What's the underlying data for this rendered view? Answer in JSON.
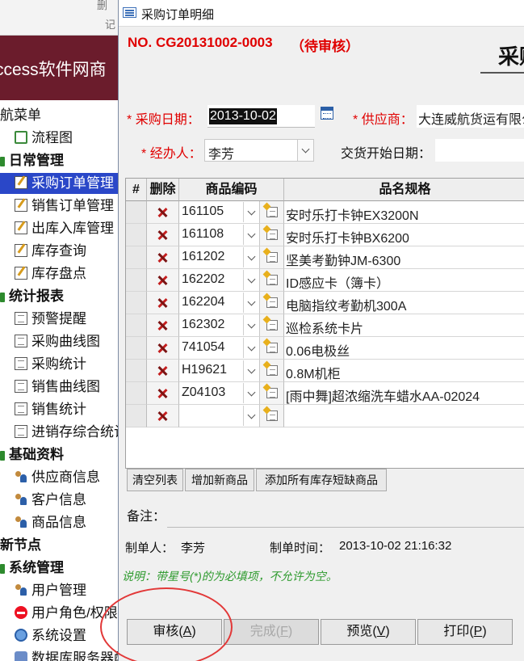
{
  "background_app": {
    "top_fragment_1": "删",
    "top_fragment_2": "记",
    "banner_text": "ccess软件网商",
    "nav": [
      {
        "label": "航菜单",
        "type": "header",
        "icon": ""
      },
      {
        "label": "流程图",
        "type": "item",
        "icon": "flowchart-icon"
      },
      {
        "label": "日常管理",
        "type": "group",
        "icon": "group-icon"
      },
      {
        "label": "采购订单管理",
        "type": "item",
        "icon": "edit-form-icon",
        "selected": true
      },
      {
        "label": "销售订单管理",
        "type": "item",
        "icon": "edit-form-icon"
      },
      {
        "label": "出库入库管理",
        "type": "item",
        "icon": "edit-form-icon"
      },
      {
        "label": "库存查询",
        "type": "item",
        "icon": "edit-form-icon"
      },
      {
        "label": "库存盘点",
        "type": "item",
        "icon": "edit-form-icon"
      },
      {
        "label": "统计报表",
        "type": "group",
        "icon": "group-icon"
      },
      {
        "label": "预警提醒",
        "type": "item",
        "icon": "report-icon"
      },
      {
        "label": "采购曲线图",
        "type": "item",
        "icon": "report-icon"
      },
      {
        "label": "采购统计",
        "type": "item",
        "icon": "report-icon"
      },
      {
        "label": "销售曲线图",
        "type": "item",
        "icon": "report-icon"
      },
      {
        "label": "销售统计",
        "type": "item",
        "icon": "report-icon"
      },
      {
        "label": "进销存综合统计",
        "type": "item",
        "icon": "report-icon"
      },
      {
        "label": "基础资料",
        "type": "group",
        "icon": "group-icon"
      },
      {
        "label": "供应商信息",
        "type": "item",
        "icon": "users-icon"
      },
      {
        "label": "客户信息",
        "type": "item",
        "icon": "users-icon"
      },
      {
        "label": "商品信息",
        "type": "item",
        "icon": "goods-icon"
      },
      {
        "label": "新节点",
        "type": "group",
        "icon": ""
      },
      {
        "label": "系统管理",
        "type": "group",
        "icon": "group-icon"
      },
      {
        "label": "用户管理",
        "type": "item",
        "icon": "users-icon"
      },
      {
        "label": "用户角色/权限",
        "type": "item",
        "icon": "no-entry-icon"
      },
      {
        "label": "系统设置",
        "type": "item",
        "icon": "gear-icon"
      },
      {
        "label": "数据库服务器配置",
        "type": "item",
        "icon": "network-icon"
      }
    ]
  },
  "dialog": {
    "window_title": "采购订单明细",
    "order_no": "NO. CG20131002-0003",
    "order_status": "（待审核）",
    "big_title": "采购",
    "purchase_date": {
      "required_mark": "*",
      "label": "采购日期：",
      "value": "2013-10-02"
    },
    "supplier": {
      "required_mark": "*",
      "label": "供应商：",
      "value": "大连威航货运有限公司"
    },
    "handler": {
      "required_mark": "*",
      "label": "经办人：",
      "value": "李芳"
    },
    "delivery_start": {
      "label": "交货开始日期：",
      "value": ""
    },
    "grid": {
      "headers": {
        "select": "#",
        "delete": "删除",
        "code": "商品编码",
        "name": "品名规格"
      },
      "rows": [
        {
          "code": "161105",
          "name": "安时乐打卡钟EX3200N"
        },
        {
          "code": "161108",
          "name": "安时乐打卡钟BX6200"
        },
        {
          "code": "161202",
          "name": "坚美考勤钟JM-6300"
        },
        {
          "code": "162202",
          "name": "ID感应卡（簿卡）"
        },
        {
          "code": "162204",
          "name": "电脑指纹考勤机300A"
        },
        {
          "code": "162302",
          "name": "巡检系统卡片"
        },
        {
          "code": "741054",
          "name": "0.06电极丝"
        },
        {
          "code": "H19621",
          "name": "0.8M机柜"
        },
        {
          "code": "Z04103",
          "name": "[雨中舞]超浓缩洗车蜡水AA-02024"
        },
        {
          "code": "",
          "name": ""
        }
      ]
    },
    "grid_buttons": {
      "clear": "清空列表",
      "add": "增加新商品",
      "add_all": "添加所有库存短缺商品"
    },
    "remark_label": "备注：",
    "creator": {
      "label": "制单人：",
      "value": "李芳"
    },
    "created_time": {
      "label": "制单时间：",
      "value": "2013-10-02 21:16:32"
    },
    "note": "说明：带星号(*)的为必填项，不允许为空。",
    "footer": {
      "audit": {
        "text": "审核(",
        "key": "A",
        "end": ")"
      },
      "finish": {
        "text": "完成(",
        "key": "F",
        "end": ")"
      },
      "preview": {
        "text": "预览(",
        "key": "V",
        "end": ")"
      },
      "print": {
        "text": "打印(",
        "key": "P",
        "end": ")"
      }
    },
    "colors": {
      "required": "#e00000",
      "note": "#2d9a2d",
      "nav_selected": "#2a47c8",
      "banner": "#6b1c2c",
      "annotation_circle": "#e23838"
    }
  }
}
